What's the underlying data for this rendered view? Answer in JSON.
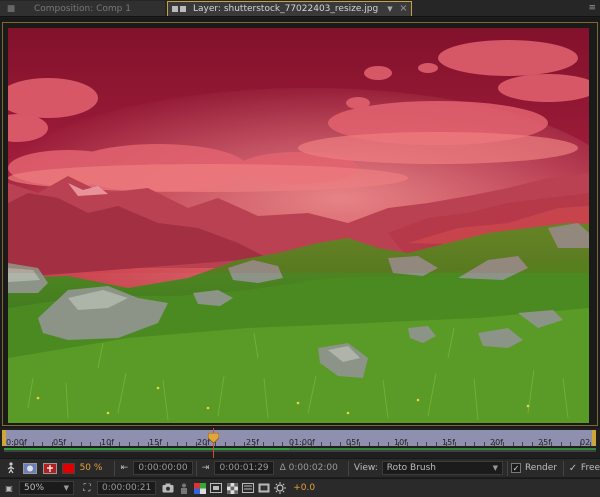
{
  "tabs": {
    "comp": {
      "label": "Composition: Comp 1"
    },
    "layer": {
      "label": "Layer: shutterstock_77022403_resize.jpg"
    }
  },
  "ruler": {
    "ticks": [
      "0:00f",
      "05f",
      "10f",
      "15f",
      "20f",
      "25f",
      "01:00f",
      "05f",
      "10f",
      "15f",
      "20f",
      "25f",
      "02"
    ]
  },
  "toolbar1": {
    "overlay_opacity": "50 %",
    "start_time": "0:00:00:00",
    "end_time": "0:00:01:29",
    "duration": "Δ 0:00:02:00",
    "view_label": "View:",
    "view_value": "Roto Brush",
    "render_label": "Render",
    "freeze_label": "Free"
  },
  "toolbar2": {
    "zoom": "50%",
    "current_time": "0:00:00:21",
    "exposure": "+0.0"
  },
  "colors": {
    "accent": "#c6a23a",
    "overlay": "#e00000",
    "cache_green": "#2c9e3a"
  }
}
